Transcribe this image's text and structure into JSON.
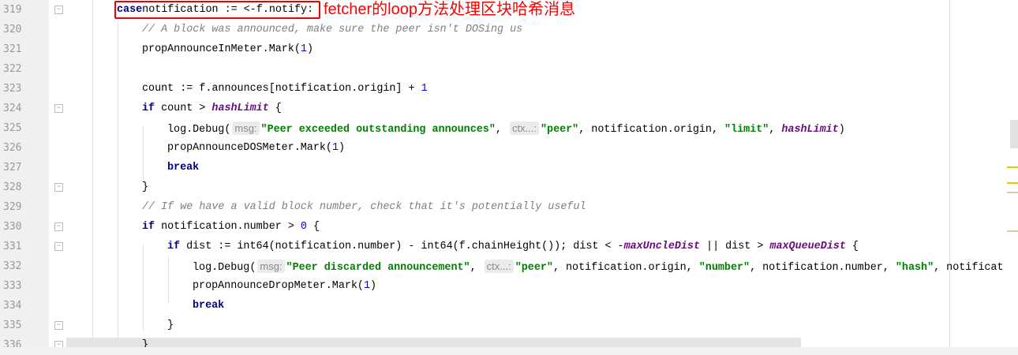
{
  "annotation": "fetcher的loop方法处理区块哈希消息",
  "lines": [
    {
      "n": "319",
      "indent": 1,
      "fold": true,
      "t": [
        [
          "kw",
          "case"
        ],
        [
          "",
          "notification := <-f.notify:"
        ]
      ]
    },
    {
      "n": "320",
      "indent": 2,
      "t": [
        [
          "cm",
          "// A block was announced, make sure the peer isn't DOSing us"
        ]
      ]
    },
    {
      "n": "321",
      "indent": 2,
      "t": [
        [
          "",
          "propAnnounceInMeter.Mark("
        ],
        [
          "num",
          "1"
        ],
        [
          "",
          ")"
        ]
      ]
    },
    {
      "n": "322",
      "indent": 2,
      "t": []
    },
    {
      "n": "323",
      "indent": 2,
      "t": [
        [
          "",
          "count := f.announces[notification.origin] + "
        ],
        [
          "num",
          "1"
        ]
      ]
    },
    {
      "n": "324",
      "indent": 2,
      "fold": true,
      "t": [
        [
          "kw",
          "if"
        ],
        [
          "",
          " count > "
        ],
        [
          "cst",
          "hashLimit"
        ],
        [
          "",
          " {"
        ]
      ]
    },
    {
      "n": "325",
      "indent": 3,
      "t": [
        [
          "",
          "log.Debug("
        ],
        [
          "hint",
          "msg:"
        ],
        [
          "str",
          "\"Peer exceeded outstanding announces\""
        ],
        [
          "",
          ", "
        ],
        [
          "hint",
          "ctx...:"
        ],
        [
          "str",
          "\"peer\""
        ],
        [
          "",
          ", notification.origin, "
        ],
        [
          "str",
          "\"limit\""
        ],
        [
          "",
          ", "
        ],
        [
          "cst",
          "hashLimit"
        ],
        [
          "",
          ")"
        ]
      ]
    },
    {
      "n": "326",
      "indent": 3,
      "t": [
        [
          "",
          "propAnnounceDOSMeter.Mark("
        ],
        [
          "num",
          "1"
        ],
        [
          "",
          ")"
        ]
      ]
    },
    {
      "n": "327",
      "indent": 3,
      "t": [
        [
          "kw",
          "break"
        ]
      ]
    },
    {
      "n": "328",
      "indent": 2,
      "fold": true,
      "t": [
        [
          "",
          "}"
        ]
      ]
    },
    {
      "n": "329",
      "indent": 2,
      "t": [
        [
          "cm",
          "// If we have a valid block number, check that it's potentially useful"
        ]
      ]
    },
    {
      "n": "330",
      "indent": 2,
      "fold": true,
      "t": [
        [
          "kw",
          "if"
        ],
        [
          "",
          " notification.number > "
        ],
        [
          "num",
          "0"
        ],
        [
          "",
          " {"
        ]
      ]
    },
    {
      "n": "331",
      "indent": 3,
      "fold": true,
      "t": [
        [
          "kw",
          "if"
        ],
        [
          "",
          " dist := int64(notification.number) - int64(f.chainHeight()); dist < -"
        ],
        [
          "cst",
          "maxUncleDist"
        ],
        [
          "",
          " || dist > "
        ],
        [
          "cst",
          "maxQueueDist"
        ],
        [
          "",
          " {"
        ]
      ]
    },
    {
      "n": "332",
      "indent": 4,
      "t": [
        [
          "",
          "log.Debug("
        ],
        [
          "hint",
          "msg:"
        ],
        [
          "str",
          "\"Peer discarded announcement\""
        ],
        [
          "",
          ", "
        ],
        [
          "hint",
          "ctx...:"
        ],
        [
          "str",
          "\"peer\""
        ],
        [
          "",
          ", notification.origin, "
        ],
        [
          "str",
          "\"number\""
        ],
        [
          "",
          ", notification.number, "
        ],
        [
          "str",
          "\"hash\""
        ],
        [
          "",
          ", notificat"
        ]
      ]
    },
    {
      "n": "333",
      "indent": 4,
      "t": [
        [
          "",
          "propAnnounceDropMeter.Mark("
        ],
        [
          "num",
          "1"
        ],
        [
          "",
          ")"
        ]
      ]
    },
    {
      "n": "334",
      "indent": 4,
      "t": [
        [
          "kw",
          "break"
        ]
      ]
    },
    {
      "n": "335",
      "indent": 3,
      "fold": true,
      "t": [
        [
          "",
          "}"
        ]
      ]
    },
    {
      "n": "336",
      "indent": 2,
      "fold": true,
      "t": [
        [
          "",
          "}"
        ]
      ]
    }
  ],
  "colors": {
    "keyword": "#000080",
    "string": "#008000",
    "number": "#0000ff",
    "comment": "#808080",
    "constant": "#660e7a",
    "annotation": "#ff0000"
  }
}
